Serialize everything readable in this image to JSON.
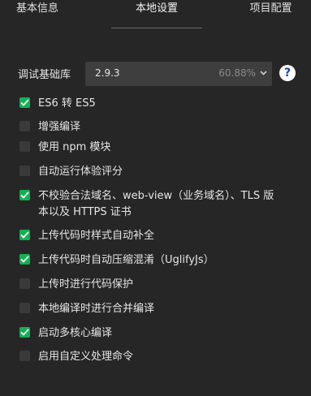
{
  "tabs": [
    {
      "label": "基本信息",
      "active": false
    },
    {
      "label": "本地设置",
      "active": true
    },
    {
      "label": "项目配置",
      "active": false
    }
  ],
  "library": {
    "label": "调试基础库",
    "version": "2.9.3",
    "percent": "60.88%",
    "help": "?"
  },
  "options": [
    {
      "label": "ES6 转 ES5",
      "checked": true
    },
    {
      "label": "增强编译",
      "checked": false
    },
    {
      "label": "使用 npm 模块",
      "checked": false
    },
    {
      "label": "自动运行体验评分",
      "checked": false
    },
    {
      "label": "不校验合法域名、web-view（业务域名）、TLS 版",
      "label2": "本以及 HTTPS 证书",
      "checked": true
    },
    {
      "label": "上传代码时样式自动补全",
      "checked": true
    },
    {
      "label": "上传代码时自动压缩混淆（UglifyJs）",
      "checked": true
    },
    {
      "label": "上传时进行代码保护",
      "checked": false
    },
    {
      "label": "本地编译时进行合并编译",
      "checked": false
    },
    {
      "label": "启动多核心编译",
      "checked": true
    },
    {
      "label": "启用自定义处理命令",
      "checked": false
    }
  ],
  "colors": {
    "background": "#262626",
    "checked": "#14b054",
    "unchecked": "#3a3a3a",
    "select": "#3e3e3e",
    "help_icon_text": "#1a3fae"
  }
}
